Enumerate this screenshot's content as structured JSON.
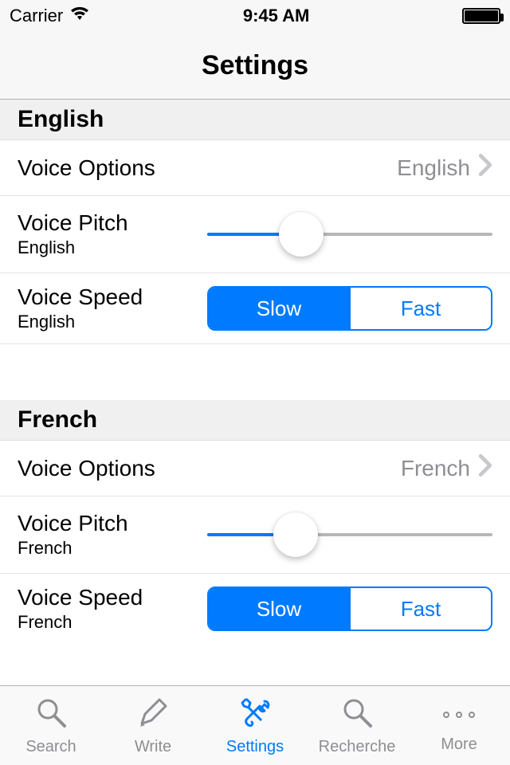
{
  "status": {
    "carrier": "Carrier",
    "time": "9:45 AM"
  },
  "nav": {
    "title": "Settings"
  },
  "sections": {
    "english": {
      "header": "English",
      "voiceOptions": {
        "label": "Voice Options",
        "value": "English"
      },
      "voicePitch": {
        "label": "Voice Pitch",
        "sub": "English",
        "percent": 33
      },
      "voiceSpeed": {
        "label": "Voice Speed",
        "sub": "English",
        "options": {
          "slow": "Slow",
          "fast": "Fast"
        },
        "selected": "slow"
      }
    },
    "french": {
      "header": "French",
      "voiceOptions": {
        "label": "Voice Options",
        "value": "French"
      },
      "voicePitch": {
        "label": "Voice Pitch",
        "sub": "French",
        "percent": 31
      },
      "voiceSpeed": {
        "label": "Voice Speed",
        "sub": "French",
        "options": {
          "slow": "Slow",
          "fast": "Fast"
        },
        "selected": "slow"
      }
    }
  },
  "tabs": {
    "search": "Search",
    "write": "Write",
    "settings": "Settings",
    "recherche": "Recherche",
    "more": "More"
  }
}
